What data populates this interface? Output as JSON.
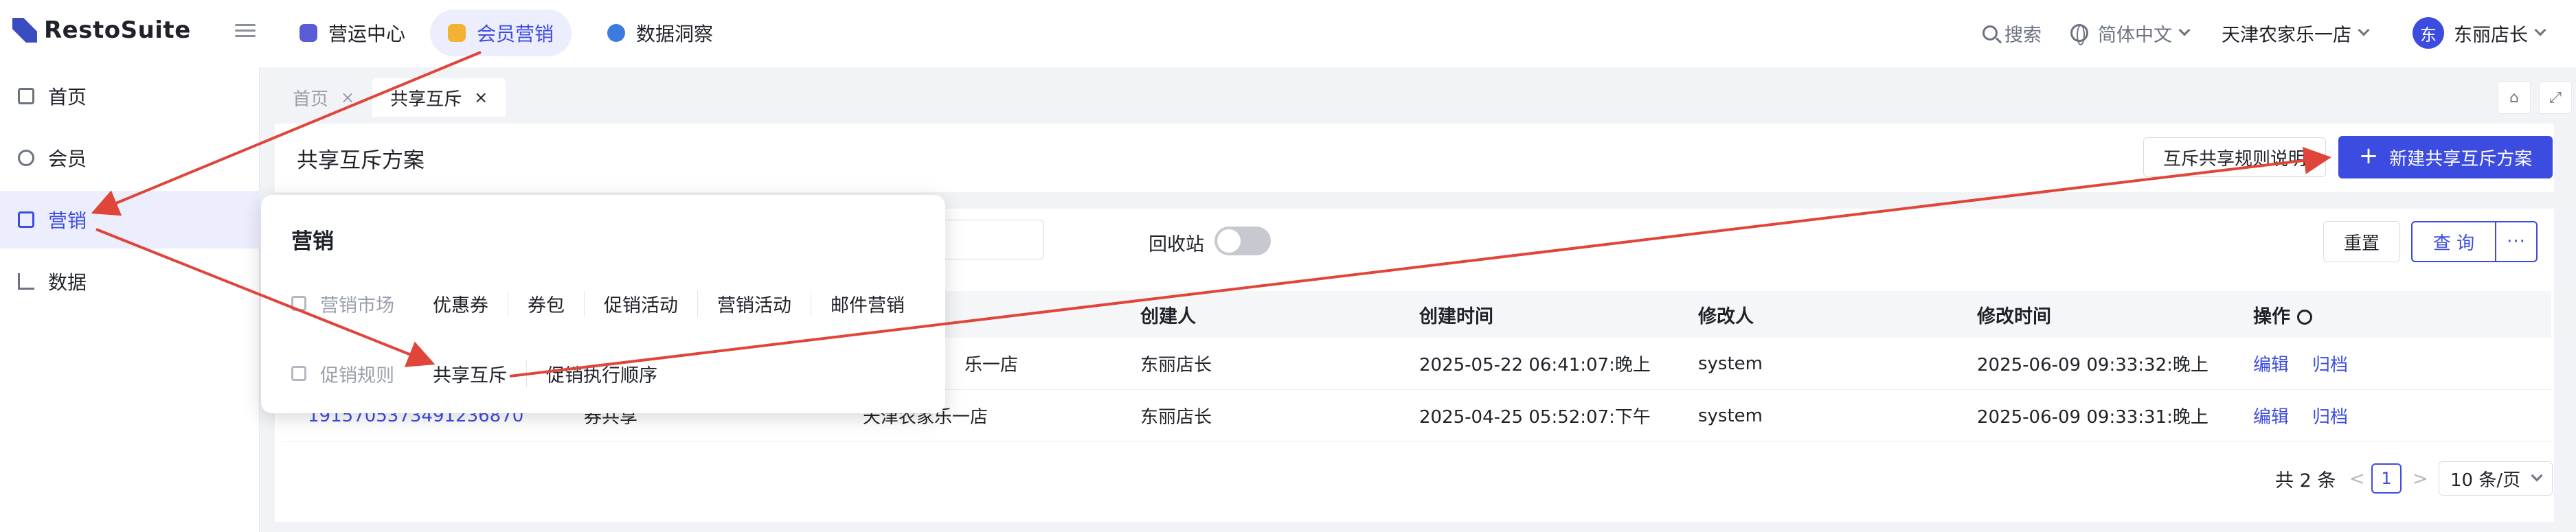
{
  "app": {
    "logo_text": "RestoSuite"
  },
  "topbar": {
    "modules": [
      {
        "label": "营运中心",
        "color": "#5b5bd6"
      },
      {
        "label": "会员营销",
        "color": "#f2b233"
      },
      {
        "label": "数据洞察",
        "color": "#3d7be0"
      }
    ],
    "search_label": "搜索",
    "language": "简体中文",
    "store": "天津农家乐一店",
    "user_initial": "东",
    "user_name": "东丽店长"
  },
  "sidebar": {
    "items": [
      {
        "label": "首页",
        "icon": "home-icon"
      },
      {
        "label": "会员",
        "icon": "member-icon"
      },
      {
        "label": "营销",
        "icon": "gift-icon"
      },
      {
        "label": "数据",
        "icon": "chart-icon"
      }
    ],
    "active": "营销"
  },
  "page_tabs": [
    {
      "label": "首页",
      "close": "×"
    },
    {
      "label": "共享互斥",
      "close": "×"
    }
  ],
  "main": {
    "title": "共享互斥方案",
    "rules_button": "互斥共享规则说明",
    "new_button": "新建共享互斥方案",
    "new_button_plus": "+"
  },
  "filters": {
    "recycle_label": "回收站",
    "recycle_on": false,
    "reset": "重置",
    "query": "查 询",
    "more": "···"
  },
  "table": {
    "columns": [
      "创建人",
      "创建时间",
      "修改人",
      "修改时间",
      "操作"
    ],
    "rows": [
      {
        "store_tail": "乐一店",
        "creator": "东丽店长",
        "created": "2025-05-22 06:41:07:晚上",
        "modifier": "system",
        "modified": "2025-06-09 09:33:32:晚上",
        "edit": "编辑",
        "archive": "归档"
      },
      {
        "id": "1915705373491236870",
        "type": "券共享",
        "store": "天津农家乐一店",
        "creator": "东丽店长",
        "created": "2025-04-25 05:52:07:下午",
        "modifier": "system",
        "modified": "2025-06-09 09:33:31:晚上",
        "edit": "编辑",
        "archive": "归档"
      }
    ]
  },
  "pagination": {
    "total": "共 2 条",
    "prev": "<",
    "page": "1",
    "next": ">",
    "page_size": "10 条/页"
  },
  "dropdown": {
    "title": "营销",
    "market": {
      "category": "营销市场",
      "items": [
        "优惠券",
        "券包",
        "促销活动",
        "营销活动",
        "邮件营销"
      ]
    },
    "rules": {
      "category": "促销规则",
      "items": [
        "共享互斥",
        "促销执行顺序"
      ]
    }
  },
  "colors": {
    "accent": "#3d4ce0",
    "annotation": "#e0453a"
  }
}
